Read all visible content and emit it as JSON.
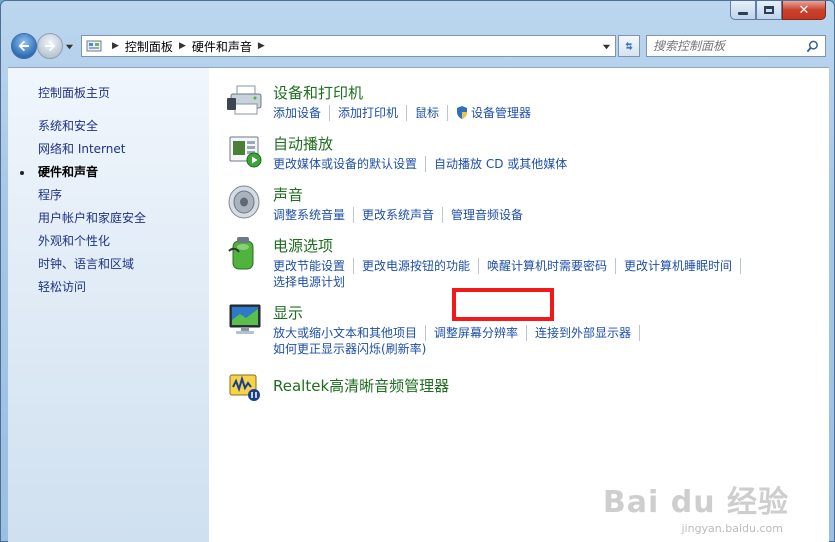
{
  "address": {
    "crumbs": [
      "控制面板",
      "硬件和声音"
    ]
  },
  "search": {
    "placeholder": "搜索控制面板"
  },
  "sidebar": {
    "items": [
      "控制面板主页",
      "系统和安全",
      "网络和 Internet",
      "硬件和声音",
      "程序",
      "用户帐户和家庭安全",
      "外观和个性化",
      "时钟、语言和区域",
      "轻松访问"
    ],
    "current_index": 3
  },
  "categories": [
    {
      "title": "设备和打印机",
      "icon": "printer-icon",
      "links": [
        "添加设备",
        "添加打印机",
        "鼠标",
        "设备管理器"
      ]
    },
    {
      "title": "自动播放",
      "icon": "autoplay-icon",
      "links": [
        "更改媒体或设备的默认设置",
        "自动播放 CD 或其他媒体"
      ]
    },
    {
      "title": "声音",
      "icon": "speaker-icon",
      "links": [
        "调整系统音量",
        "更改系统声音",
        "管理音频设备"
      ]
    },
    {
      "title": "电源选项",
      "icon": "battery-icon",
      "links": [
        "更改节能设置",
        "更改电源按钮的功能",
        "唤醒计算机时需要密码",
        "更改计算机睡眠时间",
        "选择电源计划"
      ]
    },
    {
      "title": "显示",
      "icon": "monitor-icon",
      "links": [
        "放大或缩小文本和其他项目",
        "调整屏幕分辨率",
        "连接到外部显示器",
        "如何更正显示器闪烁(刷新率)"
      ]
    },
    {
      "title": "Realtek高清晰音频管理器",
      "icon": "realtek-audio-icon",
      "links": []
    }
  ],
  "watermark": {
    "main": "Bai du 经验",
    "sub": "jingyan.baidu.com"
  },
  "colors": {
    "category_title": "#1d6e1f",
    "link": "#1e4fa8",
    "highlight": "#f21919"
  }
}
